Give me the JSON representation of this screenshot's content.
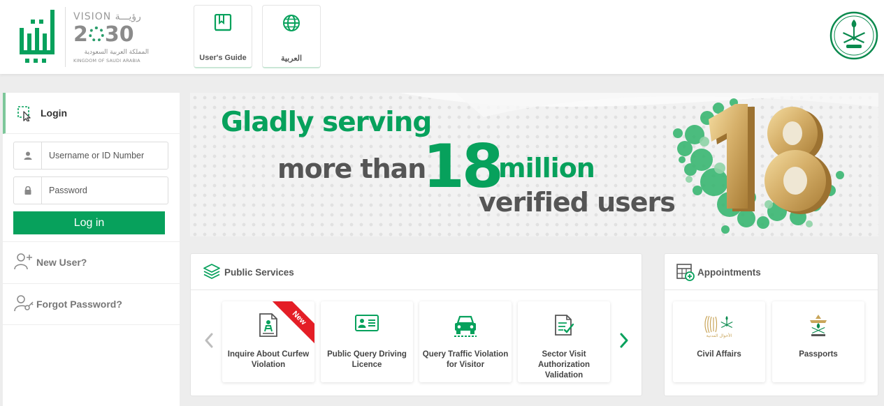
{
  "header": {
    "brand_logo": "absher-logo",
    "vision": {
      "top_text": "VISION رؤيـــة",
      "year_first": "2",
      "year_last": "30",
      "arabic_text": "المملكة العربية السعودية",
      "kingdom_text": "KINGDOM OF SAUDI ARABIA"
    },
    "buttons": [
      {
        "label": "User's Guide",
        "icon": "book-icon"
      },
      {
        "label": "العربية",
        "icon": "globe-icon"
      }
    ],
    "emblem": "saudi-emblem-icon"
  },
  "login": {
    "title": "Login",
    "username_placeholder": "Username or ID Number",
    "password_placeholder": "Password",
    "submit_label": "Log in",
    "new_user": "New User?",
    "forgot_password": "Forgot Password?"
  },
  "banner": {
    "line1": "Gladly serving",
    "line2_a": "more than",
    "number": "18",
    "line2_b": "million",
    "line3": "verified users",
    "big_number": "18"
  },
  "public_services": {
    "title": "Public Services",
    "cards": [
      {
        "label": "Inquire About Curfew Violation",
        "icon": "document-person-icon",
        "badge": "New"
      },
      {
        "label": "Public Query Driving Licence",
        "icon": "id-card-icon"
      },
      {
        "label": "Query Traffic Violation for Visitor",
        "icon": "car-icon"
      },
      {
        "label": "Sector Visit Authorization Validation",
        "icon": "document-check-icon"
      }
    ]
  },
  "appointments": {
    "title": "Appointments",
    "cards": [
      {
        "label": "Civil Affairs",
        "icon": "civil-affairs-logo",
        "logo_text": "الأحوال المدنية"
      },
      {
        "label": "Passports",
        "icon": "passports-emblem-icon"
      }
    ]
  },
  "colors": {
    "brand_green": "#07a15c",
    "badge_red": "#e41e26",
    "gold": "#c9a55a"
  }
}
